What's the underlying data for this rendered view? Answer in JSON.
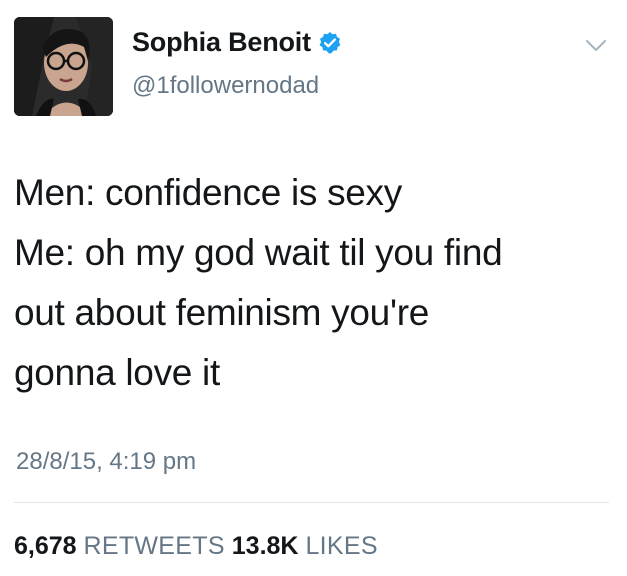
{
  "user": {
    "display_name": "Sophia Benoit",
    "handle": "@1followernodad",
    "verified": true,
    "verified_color": "#1da1f2",
    "avatar_icon": "profile-photo"
  },
  "menu_icon": "chevron-down-icon",
  "tweet": {
    "lines": [
      "Men: confidence is sexy",
      "Me: oh my god wait til you find",
      "out about feminism you're",
      "gonna love it"
    ],
    "timestamp": "28/8/15, 4:19 pm"
  },
  "stats": {
    "retweets_count": "6,678",
    "retweets_label": "RETWEETS",
    "likes_count": "13.8K",
    "likes_label": "LIKES"
  },
  "colors": {
    "text_primary": "#14171a",
    "text_secondary": "#657786",
    "divider": "#e1e8ed"
  }
}
